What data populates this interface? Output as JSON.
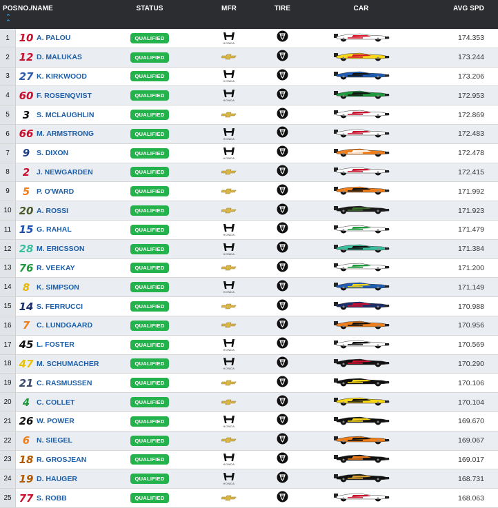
{
  "header": {
    "pos": "POS",
    "name": "NO./NAME",
    "status": "STATUS",
    "mfr": "MFR",
    "tire": "TIRE",
    "car": "CAR",
    "avg_spd": "AVG SPD"
  },
  "honda_word": "HONDA",
  "rows": [
    {
      "pos": "1",
      "num": "10",
      "name": "A. PALOU",
      "status": "QUALIFIED",
      "mfr": "honda",
      "speed": "174.353",
      "num_color": "#c8102e",
      "car_colors": [
        "#ffffff",
        "#d7182a"
      ]
    },
    {
      "pos": "2",
      "num": "12",
      "name": "D. MALUKAS",
      "status": "QUALIFIED",
      "mfr": "chevrolet",
      "speed": "173.244",
      "num_color": "#c8102e",
      "car_colors": [
        "#f7d617",
        "#d7182a"
      ]
    },
    {
      "pos": "3",
      "num": "27",
      "name": "K. KIRKWOOD",
      "status": "QUALIFIED",
      "mfr": "honda",
      "speed": "173.206",
      "num_color": "#2b5aa8",
      "car_colors": [
        "#1e5db3",
        "#111111"
      ]
    },
    {
      "pos": "4",
      "num": "60",
      "name": "F. ROSENQVIST",
      "status": "QUALIFIED",
      "mfr": "honda",
      "speed": "172.953",
      "num_color": "#c8102e",
      "car_colors": [
        "#1e9a3c",
        "#111111"
      ]
    },
    {
      "pos": "5",
      "num": "3",
      "name": "S. MCLAUGHLIN",
      "status": "QUALIFIED",
      "mfr": "chevrolet",
      "speed": "172.869",
      "num_color": "#111111",
      "car_colors": [
        "#ffffff",
        "#c8102e"
      ]
    },
    {
      "pos": "6",
      "num": "66",
      "name": "M. ARMSTRONG",
      "status": "QUALIFIED",
      "mfr": "honda",
      "speed": "172.483",
      "num_color": "#c8102e",
      "car_colors": [
        "#ffffff",
        "#c8102e"
      ]
    },
    {
      "pos": "7",
      "num": "9",
      "name": "S. DIXON",
      "status": "QUALIFIED",
      "mfr": "honda",
      "speed": "172.478",
      "num_color": "#1c3f8a",
      "car_colors": [
        "#f07f1b",
        "#ffffff"
      ]
    },
    {
      "pos": "8",
      "num": "2",
      "name": "J. NEWGARDEN",
      "status": "QUALIFIED",
      "mfr": "chevrolet",
      "speed": "172.415",
      "num_color": "#c8102e",
      "car_colors": [
        "#ffffff",
        "#c8102e"
      ]
    },
    {
      "pos": "9",
      "num": "5",
      "name": "P. O'WARD",
      "status": "QUALIFIED",
      "mfr": "chevrolet",
      "speed": "171.992",
      "num_color": "#f07f1b",
      "car_colors": [
        "#f07f1b",
        "#111111"
      ]
    },
    {
      "pos": "10",
      "num": "20",
      "name": "A. ROSSI",
      "status": "QUALIFIED",
      "mfr": "chevrolet",
      "speed": "171.923",
      "num_color": "#4a5a2a",
      "car_colors": [
        "#1a1a1a",
        "#3a6b2a"
      ]
    },
    {
      "pos": "11",
      "num": "15",
      "name": "G. RAHAL",
      "status": "QUALIFIED",
      "mfr": "honda",
      "speed": "171.479",
      "num_color": "#1c4fb0",
      "car_colors": [
        "#ffffff",
        "#1e9a3c"
      ]
    },
    {
      "pos": "12",
      "num": "28",
      "name": "M. ERICSSON",
      "status": "QUALIFIED",
      "mfr": "honda",
      "speed": "171.384",
      "num_color": "#3bbf9e",
      "car_colors": [
        "#3bbf9e",
        "#111111"
      ]
    },
    {
      "pos": "13",
      "num": "76",
      "name": "R. VEEKAY",
      "status": "QUALIFIED",
      "mfr": "chevrolet",
      "speed": "171.200",
      "num_color": "#1e9a3c",
      "car_colors": [
        "#ffffff",
        "#1e9a3c"
      ]
    },
    {
      "pos": "14",
      "num": "8",
      "name": "K. SIMPSON",
      "status": "QUALIFIED",
      "mfr": "honda",
      "speed": "171.149",
      "num_color": "#e8b800",
      "car_colors": [
        "#1e5db3",
        "#f7d617"
      ]
    },
    {
      "pos": "15",
      "num": "14",
      "name": "S. FERRUCCI",
      "status": "QUALIFIED",
      "mfr": "chevrolet",
      "speed": "170.988",
      "num_color": "#1c2f6a",
      "car_colors": [
        "#1c2f6a",
        "#c8102e"
      ]
    },
    {
      "pos": "16",
      "num": "7",
      "name": "C. LUNDGAARD",
      "status": "QUALIFIED",
      "mfr": "chevrolet",
      "speed": "170.956",
      "num_color": "#f07f1b",
      "car_colors": [
        "#f07f1b",
        "#111111"
      ]
    },
    {
      "pos": "17",
      "num": "45",
      "name": "L. FOSTER",
      "status": "QUALIFIED",
      "mfr": "honda",
      "speed": "170.569",
      "num_color": "#111111",
      "car_colors": [
        "#ffffff",
        "#111111"
      ]
    },
    {
      "pos": "18",
      "num": "47",
      "name": "M. SCHUMACHER",
      "status": "QUALIFIED",
      "mfr": "honda",
      "speed": "170.290",
      "num_color": "#e8c400",
      "car_colors": [
        "#111111",
        "#c8102e"
      ]
    },
    {
      "pos": "19",
      "num": "21",
      "name": "C. RASMUSSEN",
      "status": "QUALIFIED",
      "mfr": "chevrolet",
      "speed": "170.106",
      "num_color": "#3a4a6a",
      "car_colors": [
        "#111111",
        "#f7d617"
      ]
    },
    {
      "pos": "20",
      "num": "4",
      "name": "C. COLLET",
      "status": "QUALIFIED",
      "mfr": "chevrolet",
      "speed": "170.104",
      "num_color": "#1e9a3c",
      "car_colors": [
        "#f7d617",
        "#111111"
      ]
    },
    {
      "pos": "21",
      "num": "26",
      "name": "W. POWER",
      "status": "QUALIFIED",
      "mfr": "honda",
      "speed": "169.670",
      "num_color": "#111111",
      "car_colors": [
        "#111111",
        "#f7d617"
      ]
    },
    {
      "pos": "22",
      "num": "6",
      "name": "N. SIEGEL",
      "status": "QUALIFIED",
      "mfr": "chevrolet",
      "speed": "169.067",
      "num_color": "#f07f1b",
      "car_colors": [
        "#f07f1b",
        "#111111"
      ]
    },
    {
      "pos": "23",
      "num": "18",
      "name": "R. GROSJEAN",
      "status": "QUALIFIED",
      "mfr": "honda",
      "speed": "169.017",
      "num_color": "#b35a00",
      "car_colors": [
        "#111111",
        "#f07f1b"
      ]
    },
    {
      "pos": "24",
      "num": "19",
      "name": "D. HAUGER",
      "status": "QUALIFIED",
      "mfr": "honda",
      "speed": "168.731",
      "num_color": "#b35a00",
      "car_colors": [
        "#111111",
        "#d8a030"
      ]
    },
    {
      "pos": "25",
      "num": "77",
      "name": "S. ROBB",
      "status": "QUALIFIED",
      "mfr": "chevrolet",
      "speed": "168.063",
      "num_color": "#c8102e",
      "car_colors": [
        "#ffffff",
        "#c8102e"
      ]
    }
  ]
}
